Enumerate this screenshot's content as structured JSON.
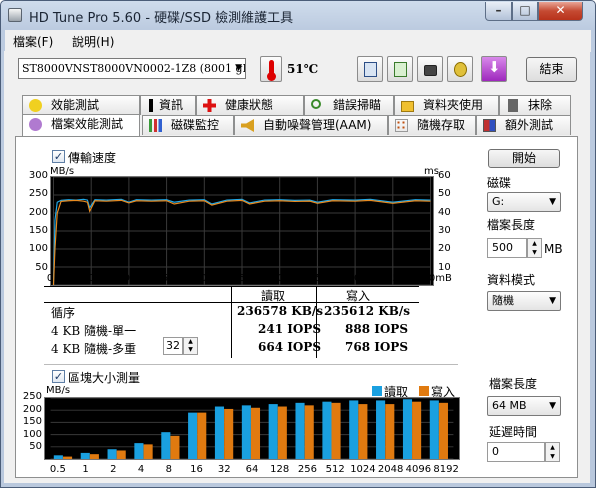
{
  "window": {
    "title": "HD Tune Pro 5.60 - 硬碟/SSD 檢測維護工具",
    "minimize": "–",
    "maximize": "□",
    "close": "✕"
  },
  "menu": {
    "file": "檔案(F)",
    "help": "說明(H)"
  },
  "toolbar": {
    "drive": "ST8000VNST8000VN0002-1Z8 (8001 gB",
    "temperature": "51℃",
    "exit_label": "結束"
  },
  "tabs_row1": [
    "效能測試",
    "資訊",
    "健康狀態",
    "錯誤掃瞄",
    "資料夾使用",
    "抹除"
  ],
  "tabs_row2": [
    "檔案效能測試",
    "磁碟監控",
    "自動噪聲管理(AAM)",
    "隨機存取",
    "額外測試"
  ],
  "transfer": {
    "checkbox_label": "傳輸速度",
    "y_unit_left": "MB/s",
    "y_unit_right": "ms",
    "y_ticks_left": [
      "300",
      "250",
      "200",
      "150",
      "100",
      "50"
    ],
    "y_ticks_right": [
      "60",
      "50",
      "40",
      "30",
      "20",
      "10"
    ],
    "x_ticks": [
      "0",
      "50",
      "100",
      "150",
      "200",
      "250",
      "300",
      "350",
      "400",
      "450",
      "500mB"
    ]
  },
  "results": {
    "col_read": "讀取",
    "col_write": "寫入",
    "row_seq": "循序",
    "seq_read": "236578 KB/s",
    "seq_write": "235612 KB/s",
    "row_4k_single": "4 KB 隨機-單一",
    "single_read": "241 IOPS",
    "single_write": "888 IOPS",
    "row_4k_multi": "4 KB 隨機-多重",
    "queue_depth": "32",
    "multi_read": "664 IOPS",
    "multi_write": "768 IOPS"
  },
  "block": {
    "checkbox_label": "區塊大小測量",
    "y_unit": "MB/s",
    "legend_read": "讀取",
    "legend_write": "寫入",
    "y_ticks": [
      "250",
      "200",
      "150",
      "100",
      "50"
    ],
    "x_ticks": [
      "0.5",
      "1",
      "2",
      "4",
      "8",
      "16",
      "32",
      "64",
      "128",
      "256",
      "512",
      "1024",
      "2048",
      "4096",
      "8192"
    ]
  },
  "side1": {
    "start_label": "開始",
    "drive_label": "磁碟",
    "drive_value": "G:",
    "file_length_label": "檔案長度",
    "file_length_value": "500",
    "file_length_unit": "MB",
    "data_mode_label": "資料模式",
    "data_mode_value": "隨機"
  },
  "side2": {
    "file_length_label": "檔案長度",
    "file_length_value": "64 MB",
    "delay_label": "延遲時間",
    "delay_value": "0"
  },
  "chart_data": [
    {
      "type": "line",
      "title": "傳輸速度",
      "ylabel": "MB/s",
      "y2label": "ms",
      "ylim": [
        0,
        300
      ],
      "y2lim": [
        0,
        60
      ],
      "xlim": [
        0,
        500
      ],
      "series": [
        {
          "name": "讀取",
          "x": [
            0,
            2,
            5,
            10,
            20,
            30,
            40,
            45,
            48,
            55,
            70,
            90,
            100,
            110,
            130,
            150,
            160,
            180,
            200,
            210,
            230,
            250,
            260,
            280,
            300,
            320,
            340,
            350,
            370,
            400,
            420,
            450,
            480,
            500
          ],
          "values": [
            0,
            180,
            230,
            235,
            237,
            236,
            238,
            236,
            215,
            237,
            236,
            238,
            230,
            237,
            236,
            237,
            230,
            236,
            237,
            225,
            236,
            238,
            228,
            236,
            237,
            235,
            236,
            230,
            237,
            236,
            238,
            230,
            237,
            236
          ]
        },
        {
          "name": "寫入",
          "x": [
            0,
            2,
            5,
            10,
            20,
            30,
            40,
            45,
            48,
            55,
            70,
            90,
            100,
            110,
            130,
            150,
            160,
            180,
            200,
            210,
            230,
            250,
            260,
            280,
            300,
            320,
            340,
            350,
            370,
            400,
            420,
            450,
            480,
            500
          ],
          "values": [
            0,
            100,
            200,
            232,
            234,
            235,
            233,
            230,
            205,
            234,
            233,
            235,
            228,
            234,
            233,
            234,
            225,
            233,
            234,
            222,
            233,
            235,
            225,
            233,
            234,
            232,
            233,
            227,
            234,
            233,
            235,
            227,
            234,
            233
          ]
        }
      ]
    },
    {
      "type": "bar",
      "title": "區塊大小測量",
      "ylabel": "MB/s",
      "ylim": [
        0,
        250
      ],
      "categories": [
        "0.5",
        "1",
        "2",
        "4",
        "8",
        "16",
        "32",
        "64",
        "128",
        "256",
        "512",
        "1024",
        "2048",
        "4096",
        "8192"
      ],
      "series": [
        {
          "name": "讀取",
          "values": [
            15,
            25,
            40,
            65,
            110,
            190,
            215,
            220,
            225,
            230,
            235,
            240,
            240,
            245,
            240
          ]
        },
        {
          "name": "寫入",
          "values": [
            10,
            20,
            35,
            60,
            95,
            190,
            205,
            210,
            215,
            220,
            230,
            225,
            225,
            235,
            230
          ]
        }
      ]
    }
  ]
}
